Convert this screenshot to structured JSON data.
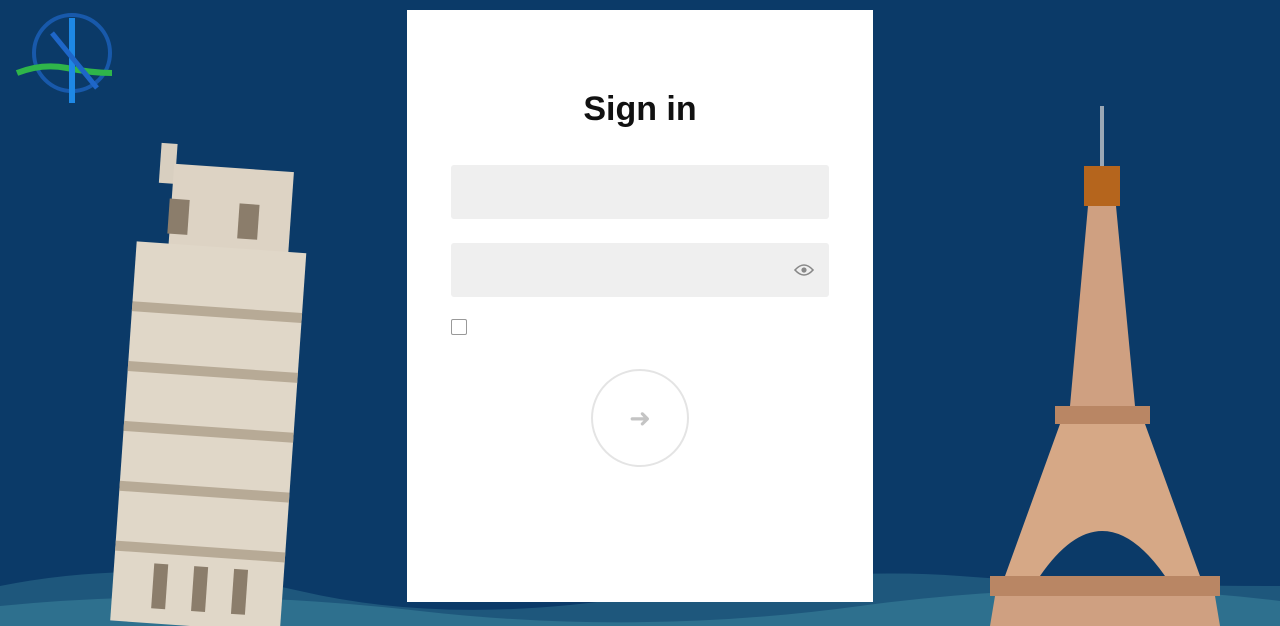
{
  "logo": {
    "line1": "",
    "badge": "",
    "line2": ""
  },
  "signin": {
    "title": "Sign in",
    "username_placeholder": "",
    "password_placeholder": "",
    "remember_label": "",
    "submit_icon": "arrow-right-icon",
    "footer_line1": "",
    "footer_line2": ""
  },
  "colors": {
    "background": "#0b3a68",
    "card": "#ffffff",
    "brand_blue": "#1e88e5",
    "brand_green": "#2fb54a",
    "field": "#efefef"
  }
}
